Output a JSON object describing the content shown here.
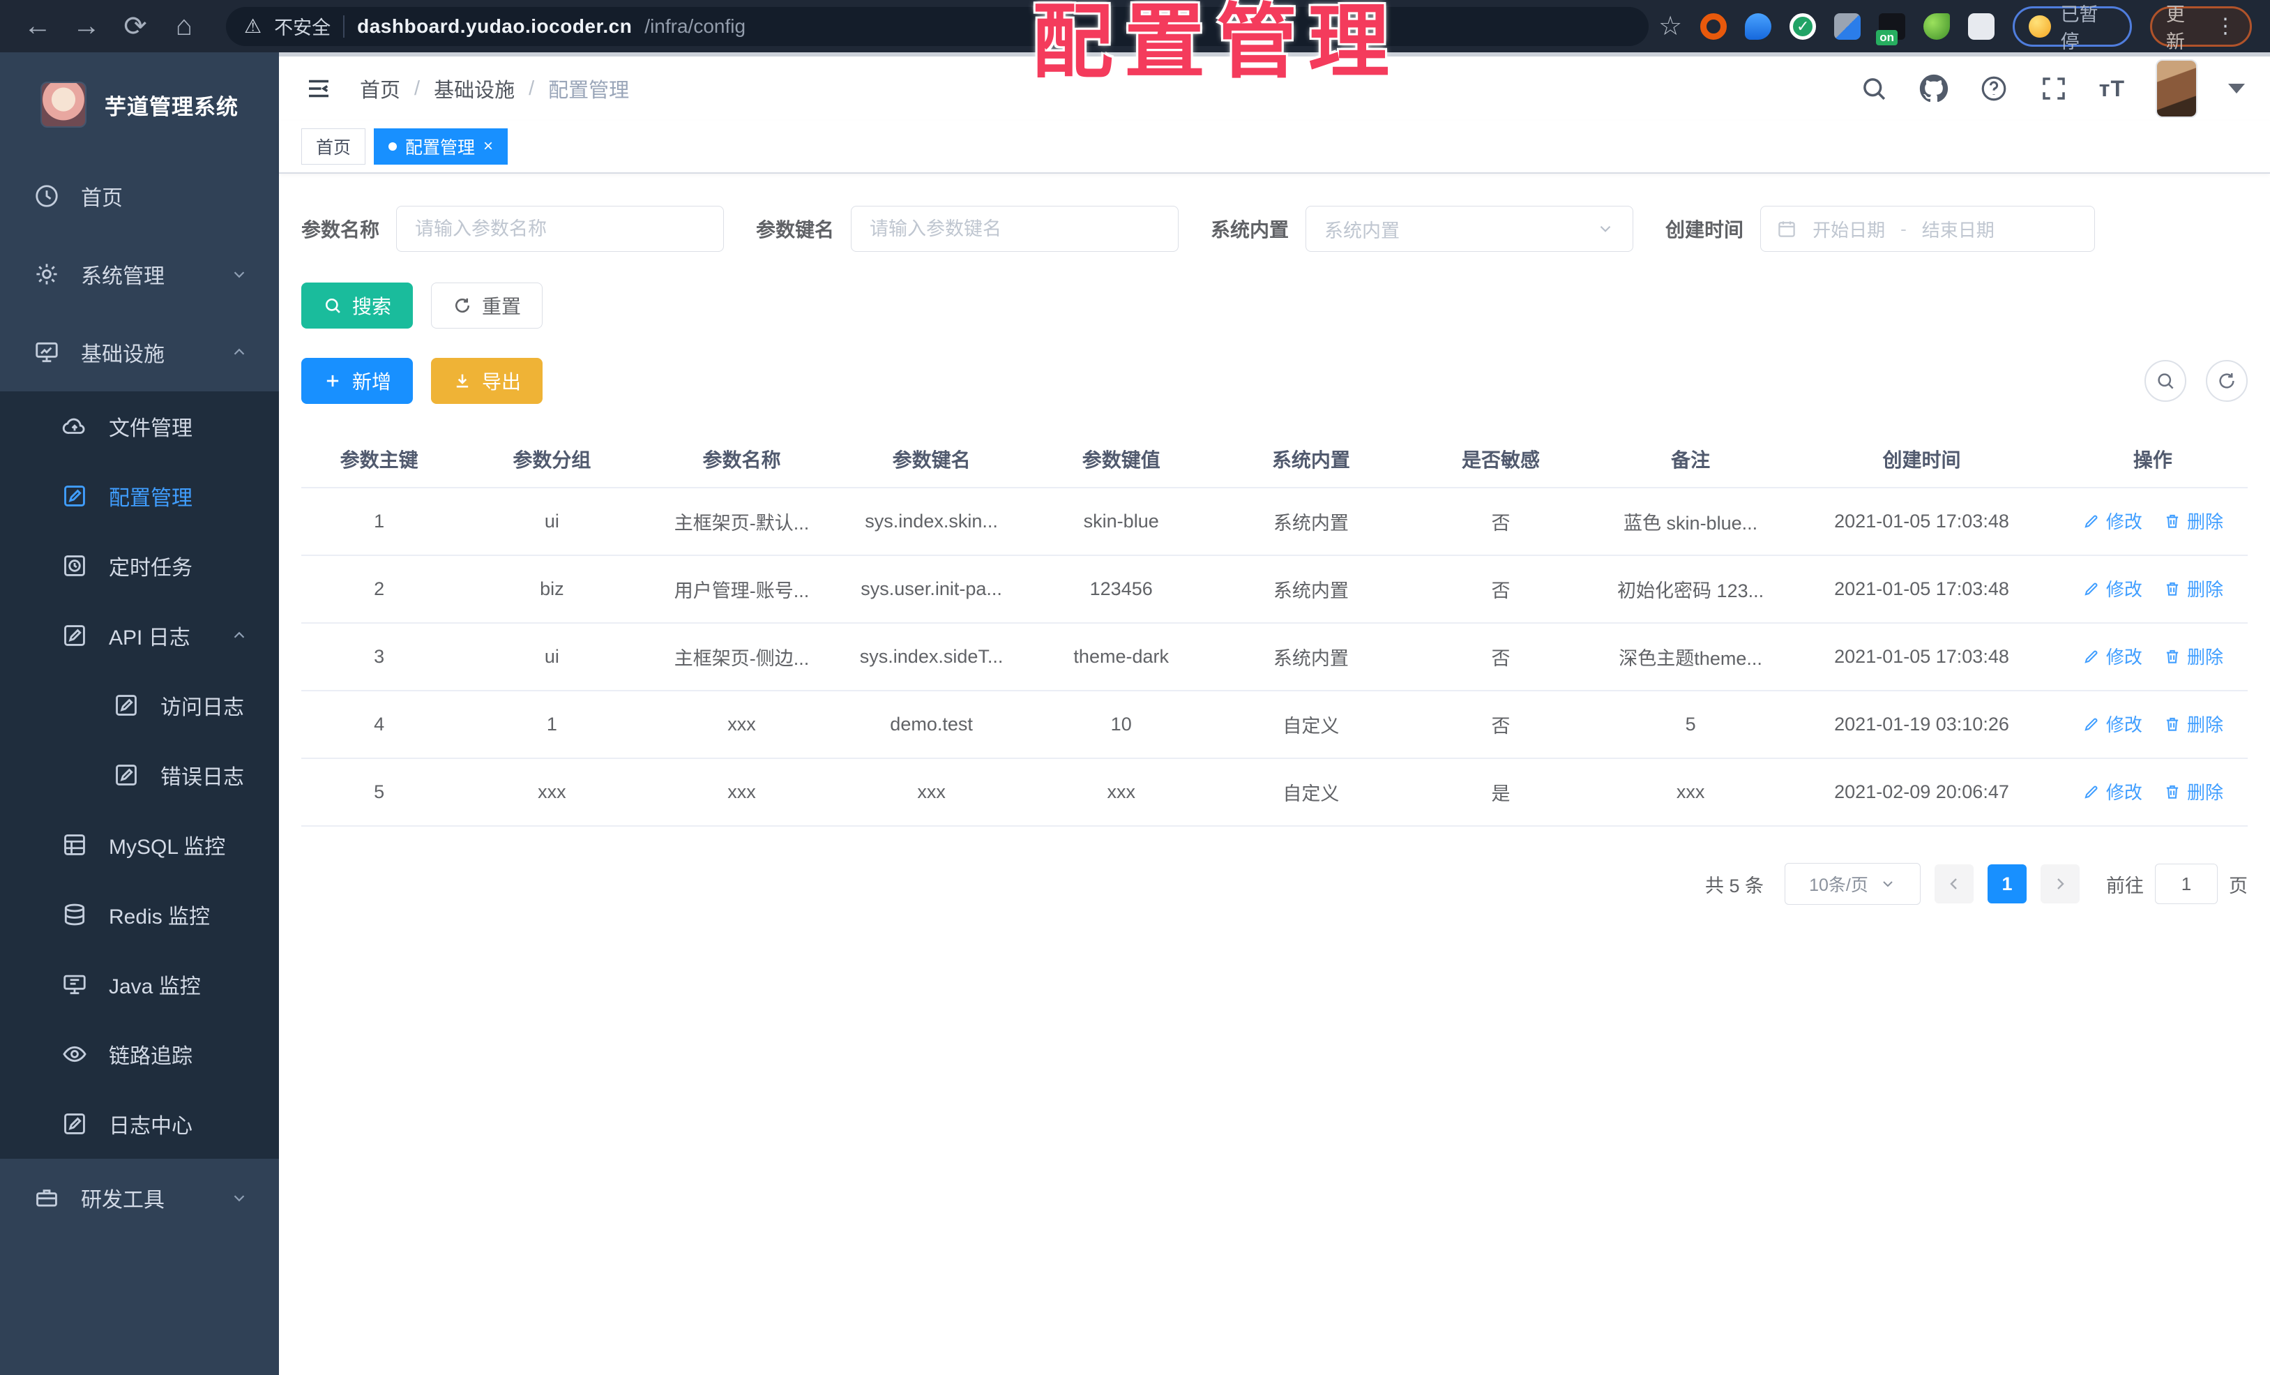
{
  "browser": {
    "warning": "不安全",
    "url_host": "dashboard.yudao.iocoder.cn",
    "url_path": "/infra/config",
    "paused_label": "已暂停",
    "update_label": "更新"
  },
  "overlay": {
    "title": "配置管理"
  },
  "sidebar": {
    "app_title": "芋道管理系统",
    "items": [
      {
        "label": "首页",
        "icon": "home-icon",
        "level": 1
      },
      {
        "label": "系统管理",
        "icon": "gear-icon",
        "level": 1,
        "chevron": "down"
      },
      {
        "label": "基础设施",
        "icon": "infra-icon",
        "level": 1,
        "chevron": "up"
      },
      {
        "label": "文件管理",
        "icon": "cloud-icon",
        "level": 2
      },
      {
        "label": "配置管理",
        "icon": "edit-icon",
        "level": 2,
        "active": true
      },
      {
        "label": "定时任务",
        "icon": "clock-icon",
        "level": 2
      },
      {
        "label": "API 日志",
        "icon": "edit-icon",
        "level": 2,
        "chevron": "up"
      },
      {
        "label": "访问日志",
        "icon": "edit-icon",
        "level": 3
      },
      {
        "label": "错误日志",
        "icon": "edit-icon",
        "level": 3
      },
      {
        "label": "MySQL 监控",
        "icon": "mysql-icon",
        "level": 2
      },
      {
        "label": "Redis 监控",
        "icon": "redis-icon",
        "level": 2
      },
      {
        "label": "Java 监控",
        "icon": "java-icon",
        "level": 2
      },
      {
        "label": "链路追踪",
        "icon": "eye-icon",
        "level": 2
      },
      {
        "label": "日志中心",
        "icon": "edit-icon",
        "level": 2
      },
      {
        "label": "研发工具",
        "icon": "briefcase-icon",
        "level": 1,
        "chevron": "down"
      }
    ]
  },
  "header": {
    "breadcrumb": [
      "首页",
      "基础设施",
      "配置管理"
    ]
  },
  "tabs": [
    {
      "label": "首页",
      "active": false
    },
    {
      "label": "配置管理",
      "active": true,
      "close": "×"
    }
  ],
  "filters": {
    "name": {
      "label": "参数名称",
      "placeholder": "请输入参数名称"
    },
    "key": {
      "label": "参数键名",
      "placeholder": "请输入参数键名"
    },
    "type": {
      "label": "系统内置",
      "placeholder": "系统内置"
    },
    "time": {
      "label": "创建时间",
      "start": "开始日期",
      "sep": "-",
      "end": "结束日期"
    }
  },
  "actions": {
    "search": "搜索",
    "reset": "重置",
    "add": "新增",
    "export": "导出"
  },
  "table": {
    "columns": [
      "参数主键",
      "参数分组",
      "参数名称",
      "参数键名",
      "参数键值",
      "系统内置",
      "是否敏感",
      "备注",
      "创建时间",
      "操作"
    ],
    "rows": [
      [
        "1",
        "ui",
        "主框架页-默认...",
        "sys.index.skin...",
        "skin-blue",
        "系统内置",
        "否",
        "蓝色 skin-blue...",
        "2021-01-05 17:03:48"
      ],
      [
        "2",
        "biz",
        "用户管理-账号...",
        "sys.user.init-pa...",
        "123456",
        "系统内置",
        "否",
        "初始化密码 123...",
        "2021-01-05 17:03:48"
      ],
      [
        "3",
        "ui",
        "主框架页-侧边...",
        "sys.index.sideT...",
        "theme-dark",
        "系统内置",
        "否",
        "深色主题theme...",
        "2021-01-05 17:03:48"
      ],
      [
        "4",
        "1",
        "xxx",
        "demo.test",
        "10",
        "自定义",
        "否",
        "5",
        "2021-01-19 03:10:26"
      ],
      [
        "5",
        "xxx",
        "xxx",
        "xxx",
        "xxx",
        "自定义",
        "是",
        "xxx",
        "2021-02-09 20:06:47"
      ]
    ],
    "ops": {
      "edit": "修改",
      "delete": "删除"
    }
  },
  "pagination": {
    "total": "共 5 条",
    "page_size": "10条/页",
    "current": "1",
    "goto_label": "前往",
    "goto_value": "1",
    "unit": "页"
  },
  "colors": {
    "primary": "#1890ff",
    "link": "#409eff",
    "success": "#1abc9c",
    "warning": "#efb336",
    "annotation": "#f43b5c",
    "sidebar": "#304156",
    "submenu": "#1f2d3d"
  }
}
